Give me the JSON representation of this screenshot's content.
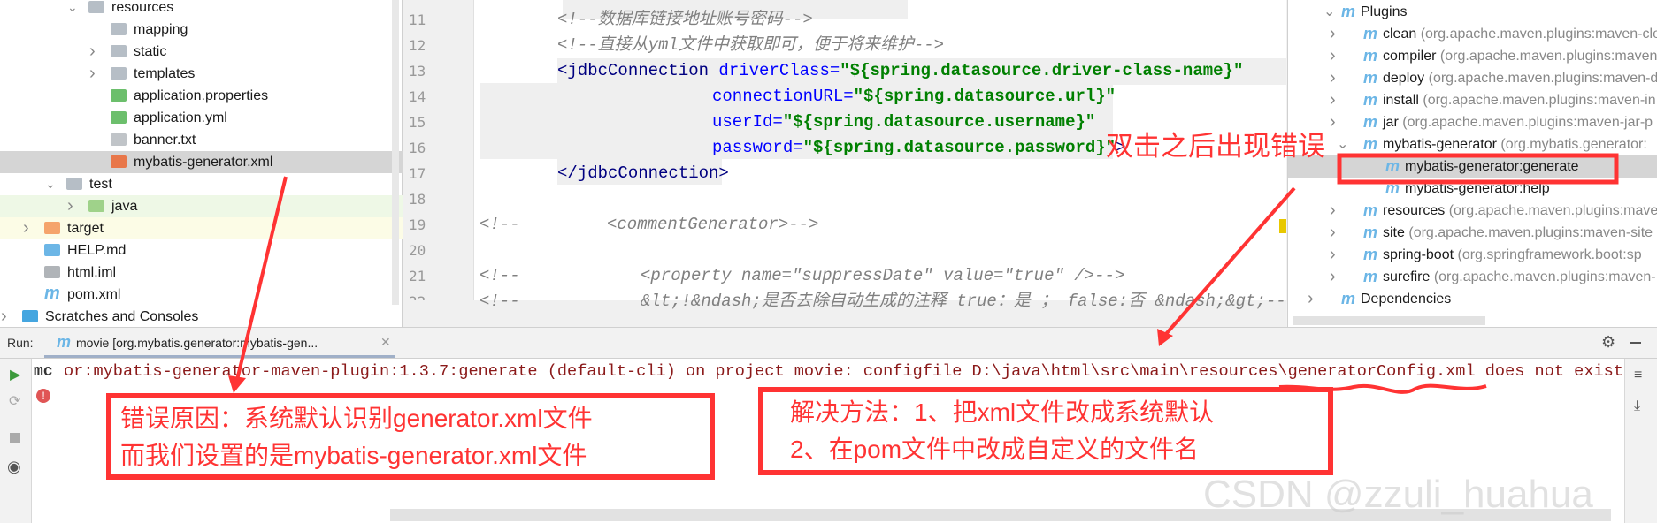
{
  "project_tree": [
    {
      "label": "resources",
      "type": "res-folder",
      "expanded": true
    },
    {
      "label": "mapping",
      "type": "folder"
    },
    {
      "label": "static",
      "type": "folder",
      "collapsed": true
    },
    {
      "label": "templates",
      "type": "folder",
      "collapsed": true
    },
    {
      "label": "application.properties",
      "type": "spring"
    },
    {
      "label": "application.yml",
      "type": "spring"
    },
    {
      "label": "banner.txt",
      "type": "text"
    },
    {
      "label": "mybatis-generator.xml",
      "type": "xml",
      "selected": true
    },
    {
      "label": "test",
      "type": "folder",
      "expanded": true
    },
    {
      "label": "java",
      "type": "test-folder",
      "collapsed": true
    },
    {
      "label": "target",
      "type": "excluded-folder",
      "collapsed": true
    },
    {
      "label": "HELP.md",
      "type": "md"
    },
    {
      "label": "html.iml",
      "type": "iml"
    },
    {
      "label": "pom.xml",
      "type": "maven"
    },
    {
      "label": "Scratches and Consoles",
      "type": "scratches",
      "collapsed": true
    }
  ],
  "editor": {
    "line_numbers": [
      "11",
      "12",
      "13",
      "14",
      "15",
      "16",
      "17",
      "18",
      "19",
      "20",
      "21",
      "22"
    ],
    "lines": {
      "l11": "<!--数据库链接地址账号密码-->",
      "l12": "<!--直接从yml文件中获取即可，便于将来维护-->",
      "l13_tag": "<jdbcConnection",
      "l13_attr": " driverClass=",
      "l13_val": "\"${spring.datasource.driver-class-name}\"",
      "l14_attr": "connectionURL=",
      "l14_val": "\"${spring.datasource.url}\"",
      "l15_attr": "userId=",
      "l15_val": "\"${spring.datasource.username}\"",
      "l16_attr": "password=",
      "l16_val": "\"${spring.datasource.password}\"",
      "l16_end": ">",
      "l17": "</jdbcConnection>",
      "l19a": "<!--",
      "l19b": "<commentGenerator>-->",
      "l21a": "<!--",
      "l21b": "<property name=\"suppressDate\" value=\"true\" />-->",
      "l22a": "<!--",
      "l22b": "&lt;!&ndash;是否去除自动生成的注释 true：是 ； false:否 &ndash;&gt;-->"
    }
  },
  "maven": {
    "plugins_label": "Plugins",
    "plugins": [
      {
        "name": "clean",
        "coord": "(org.apache.maven.plugins:maven-cle"
      },
      {
        "name": "compiler",
        "coord": "(org.apache.maven.plugins:maven"
      },
      {
        "name": "deploy",
        "coord": "(org.apache.maven.plugins:maven-d"
      },
      {
        "name": "install",
        "coord": "(org.apache.maven.plugins:maven-in"
      },
      {
        "name": "jar",
        "coord": "(org.apache.maven.plugins:maven-jar-p"
      },
      {
        "name": "mybatis-generator",
        "coord": "(org.mybatis.generator:"
      }
    ],
    "goals": [
      "mybatis-generator:generate",
      "mybatis-generator:help"
    ],
    "plugins2": [
      {
        "name": "resources",
        "coord": "(org.apache.maven.plugins:mave"
      },
      {
        "name": "site",
        "coord": "(org.apache.maven.plugins:maven-site"
      },
      {
        "name": "spring-boot",
        "coord": "(org.springframework.boot:sp"
      },
      {
        "name": "surefire",
        "coord": "(org.apache.maven.plugins:maven-"
      }
    ],
    "dependencies_label": "Dependencies"
  },
  "run": {
    "label": "Run:",
    "tab": "movie [org.mybatis.generator:mybatis-gen...",
    "tab_prefix": "mc",
    "error": "or:mybatis-generator-maven-plugin:1.3.7:generate (default-cli) on project movie: configfile D:\\java\\html\\src\\main\\resources\\generatorConfig.xml does not exist"
  },
  "annotations": {
    "double_click": "双击之后出现错误",
    "reason_1": "错误原因：系统默认识别generator.xml文件",
    "reason_2": "而我们设置的是mybatis-generator.xml文件",
    "fix_1": "解决方法：1、把xml文件改成系统默认",
    "fix_2": "2、在pom文件中改成自定义的文件名",
    "color": "#ff3333"
  },
  "watermark": "CSDN @zzuli_huahua"
}
